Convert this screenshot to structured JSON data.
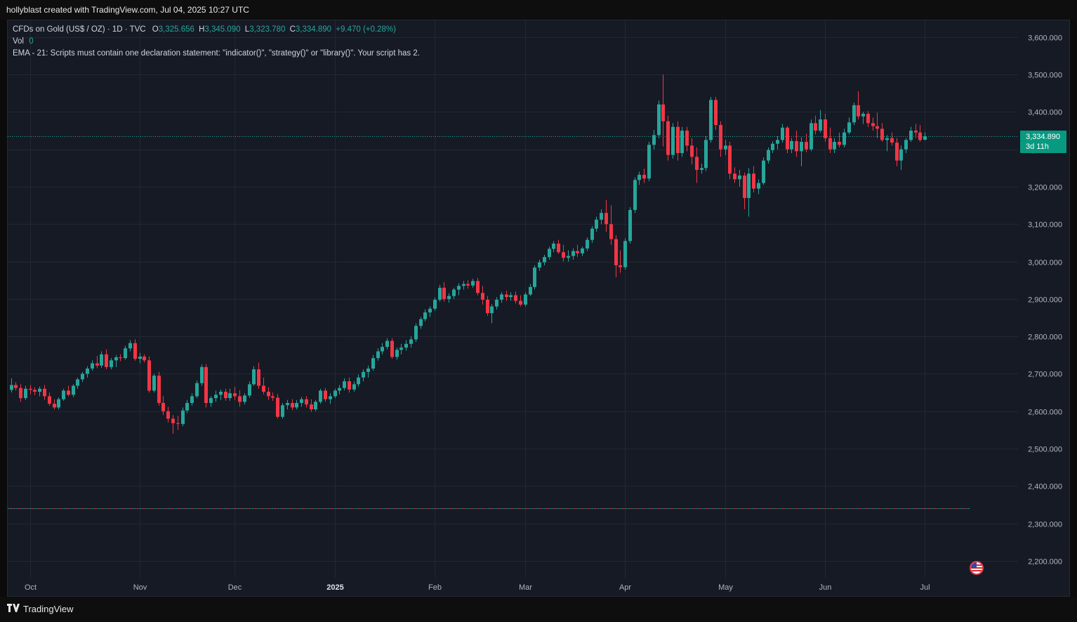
{
  "header": {
    "attribution": "hollyblast created with TradingView.com, Jul 04, 2025 10:27 UTC"
  },
  "legend": {
    "symbol": "CFDs on Gold (US$ / OZ) · 1D · TVC",
    "o_label": "O",
    "o_value": "3,325.656",
    "h_label": "H",
    "h_value": "3,345.090",
    "l_label": "L",
    "l_value": "3,323.780",
    "c_label": "C",
    "c_value": "3,334.890",
    "change": "+9.470 (+0.28%)",
    "vol_label": "Vol",
    "vol_value": "0",
    "ema_message": "EMA - 21: Scripts must contain one declaration statement: \"indicator()\", \"strategy()\" or \"library()\". Your script has 2."
  },
  "price_tag": {
    "price": "3,334.890",
    "countdown": "3d 11h"
  },
  "footer": {
    "brand": "TradingView"
  },
  "colors": {
    "up": "#26a69a",
    "down": "#f23645",
    "background": "#161a25",
    "grid": "#232733",
    "text": "#b2b5be"
  },
  "chart_data": {
    "type": "candlestick",
    "symbol": "CFDs on Gold (US$ / OZ)",
    "interval": "1D",
    "ylim": [
      2150,
      3650
    ],
    "y_ticks": [
      "3,600.000",
      "3,500.000",
      "3,400.000",
      "3,300.000",
      "3,200.000",
      "3,100.000",
      "3,000.000",
      "2,900.000",
      "2,800.000",
      "2,700.000",
      "2,600.000",
      "2,500.000",
      "2,400.000",
      "2,300.000",
      "2,200.000"
    ],
    "y_tick_values": [
      3600,
      3500,
      3400,
      3300,
      3200,
      3100,
      3000,
      2900,
      2800,
      2700,
      2600,
      2500,
      2400,
      2300,
      2200
    ],
    "x_ticks": [
      {
        "label": "Oct",
        "bar": 4,
        "bold": false
      },
      {
        "label": "Nov",
        "bar": 27,
        "bold": false
      },
      {
        "label": "Dec",
        "bar": 47,
        "bold": false
      },
      {
        "label": "2025",
        "bar": 68,
        "bold": true
      },
      {
        "label": "Feb",
        "bar": 89,
        "bold": false
      },
      {
        "label": "Mar",
        "bar": 108,
        "bold": false
      },
      {
        "label": "Apr",
        "bar": 129,
        "bold": false
      },
      {
        "label": "May",
        "bar": 150,
        "bold": false
      },
      {
        "label": "Jun",
        "bar": 171,
        "bold": false
      },
      {
        "label": "Jul",
        "bar": 192,
        "bold": false
      }
    ],
    "last_price": 3334.89,
    "reference_line": 2340,
    "candles": [
      [
        2657,
        2688,
        2650,
        2670
      ],
      [
        2670,
        2678,
        2655,
        2662
      ],
      [
        2662,
        2672,
        2625,
        2635
      ],
      [
        2635,
        2668,
        2630,
        2660
      ],
      [
        2660,
        2670,
        2645,
        2657
      ],
      [
        2657,
        2664,
        2643,
        2652
      ],
      [
        2652,
        2666,
        2640,
        2660
      ],
      [
        2660,
        2670,
        2630,
        2640
      ],
      [
        2640,
        2650,
        2615,
        2620
      ],
      [
        2620,
        2632,
        2605,
        2610
      ],
      [
        2610,
        2637,
        2605,
        2632
      ],
      [
        2632,
        2660,
        2628,
        2655
      ],
      [
        2655,
        2668,
        2640,
        2644
      ],
      [
        2644,
        2672,
        2638,
        2668
      ],
      [
        2668,
        2690,
        2660,
        2685
      ],
      [
        2685,
        2705,
        2678,
        2700
      ],
      [
        2700,
        2720,
        2690,
        2714
      ],
      [
        2714,
        2736,
        2708,
        2728
      ],
      [
        2728,
        2748,
        2715,
        2722
      ],
      [
        2722,
        2760,
        2716,
        2752
      ],
      [
        2752,
        2765,
        2712,
        2718
      ],
      [
        2718,
        2742,
        2712,
        2736
      ],
      [
        2736,
        2750,
        2718,
        2744
      ],
      [
        2744,
        2752,
        2734,
        2742
      ],
      [
        2742,
        2775,
        2738,
        2768
      ],
      [
        2768,
        2790,
        2760,
        2782
      ],
      [
        2782,
        2792,
        2735,
        2740
      ],
      [
        2740,
        2756,
        2728,
        2746
      ],
      [
        2746,
        2752,
        2730,
        2736
      ],
      [
        2736,
        2746,
        2650,
        2655
      ],
      [
        2655,
        2700,
        2650,
        2695
      ],
      [
        2695,
        2705,
        2615,
        2622
      ],
      [
        2622,
        2640,
        2590,
        2600
      ],
      [
        2600,
        2612,
        2570,
        2580
      ],
      [
        2580,
        2590,
        2540,
        2568
      ],
      [
        2568,
        2588,
        2550,
        2566
      ],
      [
        2566,
        2610,
        2560,
        2602
      ],
      [
        2602,
        2630,
        2595,
        2622
      ],
      [
        2622,
        2648,
        2615,
        2640
      ],
      [
        2640,
        2682,
        2635,
        2675
      ],
      [
        2675,
        2725,
        2668,
        2718
      ],
      [
        2718,
        2726,
        2610,
        2622
      ],
      [
        2622,
        2640,
        2612,
        2635
      ],
      [
        2635,
        2655,
        2625,
        2644
      ],
      [
        2644,
        2658,
        2630,
        2652
      ],
      [
        2652,
        2660,
        2628,
        2635
      ],
      [
        2635,
        2660,
        2628,
        2648
      ],
      [
        2648,
        2665,
        2630,
        2640
      ],
      [
        2640,
        2656,
        2612,
        2625
      ],
      [
        2625,
        2648,
        2618,
        2642
      ],
      [
        2642,
        2680,
        2636,
        2672
      ],
      [
        2672,
        2720,
        2668,
        2712
      ],
      [
        2712,
        2730,
        2660,
        2668
      ],
      [
        2668,
        2690,
        2645,
        2652
      ],
      [
        2652,
        2664,
        2630,
        2640
      ],
      [
        2640,
        2650,
        2628,
        2636
      ],
      [
        2636,
        2646,
        2580,
        2585
      ],
      [
        2585,
        2622,
        2580,
        2616
      ],
      [
        2616,
        2630,
        2605,
        2622
      ],
      [
        2622,
        2632,
        2603,
        2610
      ],
      [
        2610,
        2630,
        2605,
        2622
      ],
      [
        2622,
        2638,
        2612,
        2632
      ],
      [
        2632,
        2640,
        2610,
        2618
      ],
      [
        2618,
        2632,
        2598,
        2605
      ],
      [
        2605,
        2630,
        2600,
        2625
      ],
      [
        2625,
        2660,
        2620,
        2655
      ],
      [
        2655,
        2662,
        2625,
        2632
      ],
      [
        2632,
        2648,
        2620,
        2640
      ],
      [
        2640,
        2660,
        2635,
        2655
      ],
      [
        2655,
        2670,
        2645,
        2662
      ],
      [
        2662,
        2688,
        2656,
        2680
      ],
      [
        2680,
        2690,
        2650,
        2658
      ],
      [
        2658,
        2680,
        2652,
        2672
      ],
      [
        2672,
        2698,
        2665,
        2690
      ],
      [
        2690,
        2712,
        2680,
        2705
      ],
      [
        2705,
        2722,
        2690,
        2714
      ],
      [
        2714,
        2750,
        2708,
        2742
      ],
      [
        2742,
        2768,
        2735,
        2760
      ],
      [
        2760,
        2782,
        2752,
        2772
      ],
      [
        2772,
        2795,
        2765,
        2788
      ],
      [
        2788,
        2795,
        2740,
        2745
      ],
      [
        2745,
        2770,
        2738,
        2764
      ],
      [
        2764,
        2780,
        2752,
        2770
      ],
      [
        2770,
        2790,
        2762,
        2780
      ],
      [
        2780,
        2800,
        2770,
        2792
      ],
      [
        2792,
        2835,
        2785,
        2828
      ],
      [
        2828,
        2852,
        2820,
        2846
      ],
      [
        2846,
        2872,
        2840,
        2864
      ],
      [
        2864,
        2880,
        2852,
        2874
      ],
      [
        2874,
        2904,
        2868,
        2898
      ],
      [
        2898,
        2938,
        2893,
        2930
      ],
      [
        2930,
        2945,
        2893,
        2900
      ],
      [
        2900,
        2915,
        2890,
        2908
      ],
      [
        2908,
        2930,
        2900,
        2925
      ],
      [
        2925,
        2942,
        2910,
        2935
      ],
      [
        2935,
        2948,
        2925,
        2940
      ],
      [
        2940,
        2950,
        2928,
        2936
      ],
      [
        2936,
        2954,
        2930,
        2948
      ],
      [
        2948,
        2956,
        2910,
        2916
      ],
      [
        2916,
        2935,
        2885,
        2898
      ],
      [
        2898,
        2908,
        2855,
        2862
      ],
      [
        2862,
        2886,
        2835,
        2880
      ],
      [
        2880,
        2905,
        2872,
        2898
      ],
      [
        2898,
        2918,
        2890,
        2912
      ],
      [
        2912,
        2922,
        2895,
        2905
      ],
      [
        2905,
        2918,
        2895,
        2910
      ],
      [
        2910,
        2920,
        2888,
        2895
      ],
      [
        2895,
        2910,
        2880,
        2885
      ],
      [
        2885,
        2918,
        2880,
        2912
      ],
      [
        2912,
        2940,
        2908,
        2932
      ],
      [
        2932,
        2990,
        2925,
        2984
      ],
      [
        2984,
        3005,
        2975,
        2998
      ],
      [
        2998,
        3018,
        2990,
        3012
      ],
      [
        3012,
        3040,
        3005,
        3034
      ],
      [
        3034,
        3055,
        3025,
        3048
      ],
      [
        3048,
        3058,
        3020,
        3025
      ],
      [
        3025,
        3045,
        3000,
        3010
      ],
      [
        3010,
        3030,
        3000,
        3015
      ],
      [
        3015,
        3035,
        3005,
        3028
      ],
      [
        3028,
        3045,
        3012,
        3022
      ],
      [
        3022,
        3040,
        3015,
        3035
      ],
      [
        3035,
        3065,
        3028,
        3058
      ],
      [
        3058,
        3095,
        3050,
        3088
      ],
      [
        3088,
        3120,
        3080,
        3112
      ],
      [
        3112,
        3140,
        3100,
        3130
      ],
      [
        3130,
        3165,
        3080,
        3100
      ],
      [
        3100,
        3150,
        3045,
        3060
      ],
      [
        3060,
        3070,
        2958,
        2990
      ],
      [
        2990,
        3030,
        2970,
        2985
      ],
      [
        2985,
        3062,
        2978,
        3055
      ],
      [
        3055,
        3145,
        3048,
        3138
      ],
      [
        3138,
        3225,
        3130,
        3218
      ],
      [
        3218,
        3240,
        3205,
        3232
      ],
      [
        3232,
        3248,
        3210,
        3222
      ],
      [
        3222,
        3320,
        3215,
        3312
      ],
      [
        3312,
        3352,
        3300,
        3338
      ],
      [
        3338,
        3430,
        3330,
        3420
      ],
      [
        3420,
        3500,
        3308,
        3375
      ],
      [
        3375,
        3390,
        3270,
        3285
      ],
      [
        3285,
        3370,
        3275,
        3360
      ],
      [
        3360,
        3375,
        3270,
        3290
      ],
      [
        3290,
        3360,
        3280,
        3350
      ],
      [
        3350,
        3360,
        3295,
        3310
      ],
      [
        3310,
        3330,
        3260,
        3280
      ],
      [
        3280,
        3305,
        3210,
        3245
      ],
      [
        3245,
        3262,
        3235,
        3250
      ],
      [
        3250,
        3335,
        3242,
        3325
      ],
      [
        3325,
        3440,
        3318,
        3432
      ],
      [
        3432,
        3440,
        3352,
        3365
      ],
      [
        3365,
        3375,
        3280,
        3300
      ],
      [
        3300,
        3325,
        3285,
        3310
      ],
      [
        3310,
        3320,
        3220,
        3235
      ],
      [
        3235,
        3252,
        3210,
        3220
      ],
      [
        3220,
        3245,
        3200,
        3230
      ],
      [
        3230,
        3238,
        3140,
        3170
      ],
      [
        3170,
        3250,
        3120,
        3235
      ],
      [
        3235,
        3255,
        3185,
        3195
      ],
      [
        3195,
        3220,
        3180,
        3210
      ],
      [
        3210,
        3278,
        3205,
        3270
      ],
      [
        3270,
        3305,
        3262,
        3298
      ],
      [
        3298,
        3322,
        3290,
        3315
      ],
      [
        3315,
        3335,
        3300,
        3325
      ],
      [
        3325,
        3368,
        3318,
        3358
      ],
      [
        3358,
        3362,
        3290,
        3300
      ],
      [
        3300,
        3330,
        3290,
        3322
      ],
      [
        3322,
        3350,
        3280,
        3295
      ],
      [
        3295,
        3332,
        3255,
        3320
      ],
      [
        3320,
        3342,
        3292,
        3300
      ],
      [
        3300,
        3380,
        3295,
        3370
      ],
      [
        3370,
        3390,
        3340,
        3350
      ],
      [
        3350,
        3405,
        3345,
        3380
      ],
      [
        3380,
        3395,
        3320,
        3330
      ],
      [
        3330,
        3358,
        3290,
        3300
      ],
      [
        3300,
        3330,
        3290,
        3320
      ],
      [
        3320,
        3345,
        3305,
        3312
      ],
      [
        3312,
        3355,
        3305,
        3345
      ],
      [
        3345,
        3385,
        3340,
        3372
      ],
      [
        3372,
        3425,
        3365,
        3418
      ],
      [
        3418,
        3455,
        3380,
        3388
      ],
      [
        3388,
        3400,
        3368,
        3395
      ],
      [
        3395,
        3402,
        3360,
        3370
      ],
      [
        3370,
        3385,
        3350,
        3362
      ],
      [
        3362,
        3398,
        3330,
        3355
      ],
      [
        3355,
        3370,
        3320,
        3325
      ],
      [
        3325,
        3338,
        3295,
        3330
      ],
      [
        3330,
        3345,
        3310,
        3318
      ],
      [
        3318,
        3330,
        3255,
        3270
      ],
      [
        3270,
        3310,
        3245,
        3300
      ],
      [
        3300,
        3330,
        3290,
        3325
      ],
      [
        3325,
        3360,
        3320,
        3350
      ],
      [
        3350,
        3368,
        3330,
        3345
      ],
      [
        3345,
        3365,
        3320,
        3325
      ],
      [
        3325.656,
        3345.09,
        3323.78,
        3334.89
      ]
    ]
  }
}
